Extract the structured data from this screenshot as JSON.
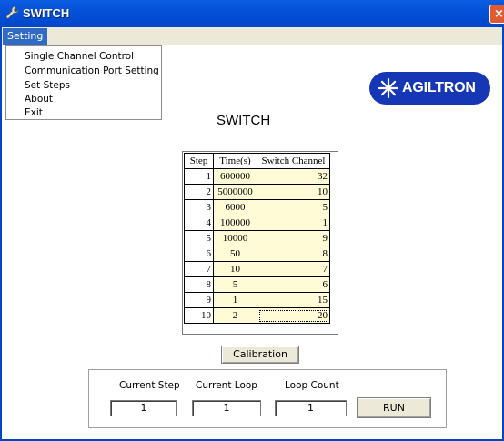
{
  "window": {
    "title": "SWITCH",
    "close_glyph": "×"
  },
  "menubar": {
    "setting_label": "Setting"
  },
  "setting_menu": {
    "items": [
      "Single Channel Control",
      "Communication Port Setting",
      "Set Steps",
      "About",
      "Exit"
    ]
  },
  "logo": {
    "text": "AGILTRON",
    "color": "#1537b5"
  },
  "main": {
    "title": "SWITCH"
  },
  "grid": {
    "headers": [
      "Step",
      "Time(s)",
      "Switch Channel"
    ],
    "rows": [
      [
        "1",
        "600000",
        "32"
      ],
      [
        "2",
        "5000000",
        "10"
      ],
      [
        "3",
        "6000",
        "5"
      ],
      [
        "4",
        "100000",
        "1"
      ],
      [
        "5",
        "10000",
        "9"
      ],
      [
        "6",
        "50",
        "8"
      ],
      [
        "7",
        "10",
        "7"
      ],
      [
        "8",
        "5",
        "6"
      ],
      [
        "9",
        "1",
        "15"
      ],
      [
        "10",
        "2",
        "20"
      ]
    ]
  },
  "buttons": {
    "calibration": "Calibration",
    "run": "RUN"
  },
  "status": {
    "current_step_label": "Current Step",
    "current_loop_label": "Current Loop",
    "loop_count_label": "Loop Count",
    "current_step_value": "1",
    "current_loop_value": "1",
    "loop_count_value": "1"
  },
  "icons": {
    "app": "wrench-icon",
    "close": "close-icon",
    "logo_mark": "starburst-icon"
  }
}
